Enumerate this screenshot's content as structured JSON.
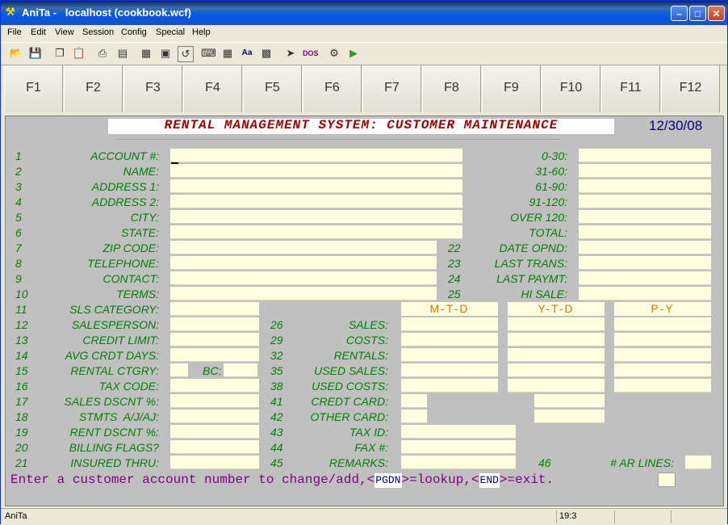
{
  "window": {
    "title": "AniTa -   localhost (cookbook.wcf)"
  },
  "menu": [
    "File",
    "Edit",
    "View",
    "Session",
    "Config",
    "Special",
    "Help"
  ],
  "toolbar_icons": [
    "open-folder-icon",
    "save-icon",
    "copy-icon",
    "paste-icon",
    "print-icon",
    "print-setup-icon",
    "select-icon",
    "font-icon",
    "capture-icon",
    "keyboard-icon",
    "table-icon",
    "text-size-icon",
    "grid-icon",
    "pointer-help-icon",
    "dos-icon",
    "settings-icon",
    "play-icon"
  ],
  "fkeys": [
    "F1",
    "F2",
    "F3",
    "F4",
    "F5",
    "F6",
    "F7",
    "F8",
    "F9",
    "F10",
    "F11",
    "F12"
  ],
  "screen": {
    "title": "RENTAL MANAGEMENT SYSTEM: CUSTOMER MAINTENANCE",
    "date": "12/30/08",
    "left_fields": [
      {
        "num": "1",
        "label": "ACCOUNT #:"
      },
      {
        "num": "2",
        "label": "NAME:"
      },
      {
        "num": "3",
        "label": "ADDRESS 1:"
      },
      {
        "num": "4",
        "label": "ADDRESS 2:"
      },
      {
        "num": "5",
        "label": "CITY:"
      },
      {
        "num": "6",
        "label": "STATE:"
      },
      {
        "num": "7",
        "label": "ZIP CODE:"
      },
      {
        "num": "8",
        "label": "TELEPHONE:"
      },
      {
        "num": "9",
        "label": "CONTACT:"
      },
      {
        "num": "10",
        "label": "TERMS:"
      },
      {
        "num": "11",
        "label": "SLS CATEGORY:"
      },
      {
        "num": "12",
        "label": "SALESPERSON:"
      },
      {
        "num": "13",
        "label": "CREDIT LIMIT:"
      },
      {
        "num": "14",
        "label": "AVG CRDT DAYS:"
      },
      {
        "num": "15",
        "label": "RENTAL CTGRY:"
      },
      {
        "num": "16",
        "label": "TAX CODE:"
      },
      {
        "num": "17",
        "label": "SALES DSCNT %:"
      },
      {
        "num": "18",
        "label": "STMTS  A/J/AJ:"
      },
      {
        "num": "19",
        "label": "RENT DSCNT %:"
      },
      {
        "num": "20",
        "label": "BILLING FLAGS?"
      },
      {
        "num": "21",
        "label": "INSURED THRU:"
      }
    ],
    "bc_label": "BC:",
    "aging": [
      "0-30:",
      "31-60:",
      "61-90:",
      "91-120:",
      "OVER 120:",
      "TOTAL:"
    ],
    "date_fields": [
      {
        "num": "22",
        "label": "DATE OPND:"
      },
      {
        "num": "23",
        "label": "LAST TRANS:"
      },
      {
        "num": "24",
        "label": "LAST PAYMT:"
      },
      {
        "num": "25",
        "label": "HI SALE:"
      }
    ],
    "col_headers": [
      "M-T-D",
      "Y-T-D",
      "P-Y"
    ],
    "mid_fields": [
      {
        "num": "26",
        "label": "SALES:"
      },
      {
        "num": "29",
        "label": "COSTS:"
      },
      {
        "num": "32",
        "label": "RENTALS:"
      },
      {
        "num": "35",
        "label": "USED SALES:"
      },
      {
        "num": "38",
        "label": "USED COSTS:"
      },
      {
        "num": "41",
        "label": "CREDT CARD:"
      },
      {
        "num": "42",
        "label": "OTHER CARD:"
      },
      {
        "num": "43",
        "label": "TAX ID:"
      },
      {
        "num": "44",
        "label": "FAX #:"
      },
      {
        "num": "45",
        "label": "REMARKS:"
      }
    ],
    "ar_num": "46",
    "ar_label": "# AR LINES:",
    "prompt": {
      "part1": "Enter a customer account number to change/add,<",
      "key1": "PGDN",
      "part2": ">=lookup,<",
      "key2": "END",
      "part3": ">=exit."
    }
  },
  "status": {
    "left": "AniTa",
    "position": "19:3"
  }
}
